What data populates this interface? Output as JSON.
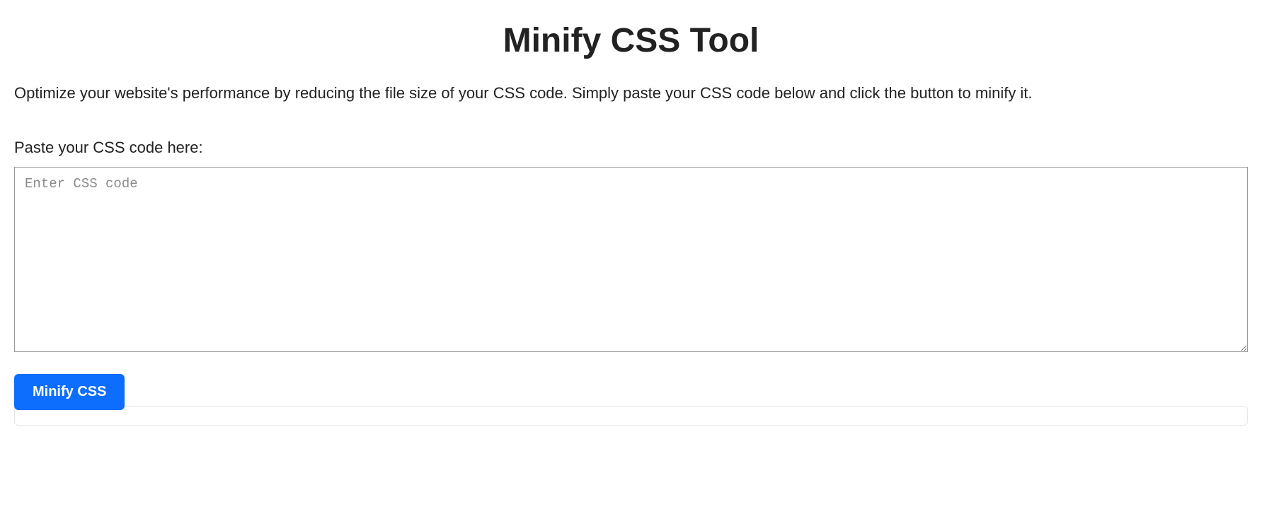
{
  "header": {
    "title": "Minify CSS Tool"
  },
  "description": "Optimize your website's performance by reducing the file size of your CSS code. Simply paste your CSS code below and click the button to minify it.",
  "input": {
    "label": "Paste your CSS code here:",
    "placeholder": "Enter CSS code",
    "value": ""
  },
  "actions": {
    "minify_label": "Minify CSS"
  },
  "output": {
    "value": ""
  }
}
